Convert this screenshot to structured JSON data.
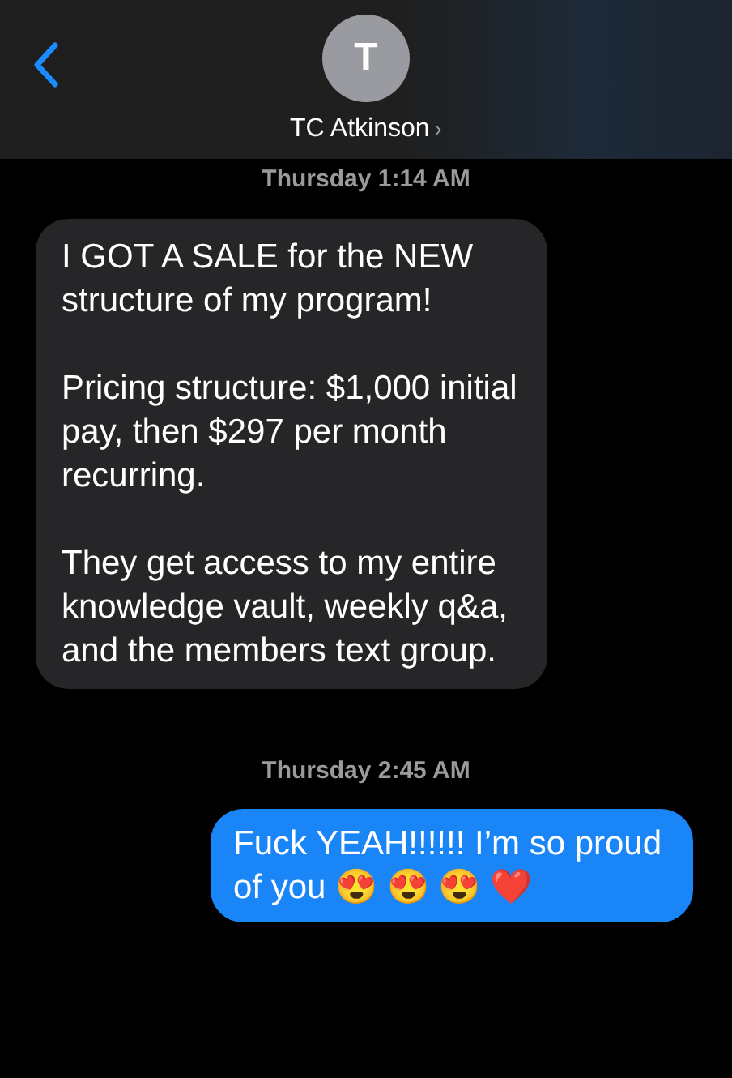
{
  "header": {
    "avatar_initial": "T",
    "contact_name": "TC Atkinson",
    "chevron": "›"
  },
  "messages": [
    {
      "kind": "timestamp",
      "text": "Thursday 1:14 AM"
    },
    {
      "kind": "received",
      "text": "I GOT A SALE for the NEW structure of my program!\n\nPricing structure: $1,000 initial pay, then $297 per month recurring.\n\nThey get access to my entire knowledge vault, weekly q&a, and the members text group."
    },
    {
      "kind": "timestamp",
      "text": "Thursday 2:45 AM"
    },
    {
      "kind": "sent",
      "text": "Fuck YEAH!!!!!! I’m so proud of you 😍 😍 😍 ❤️"
    }
  ]
}
